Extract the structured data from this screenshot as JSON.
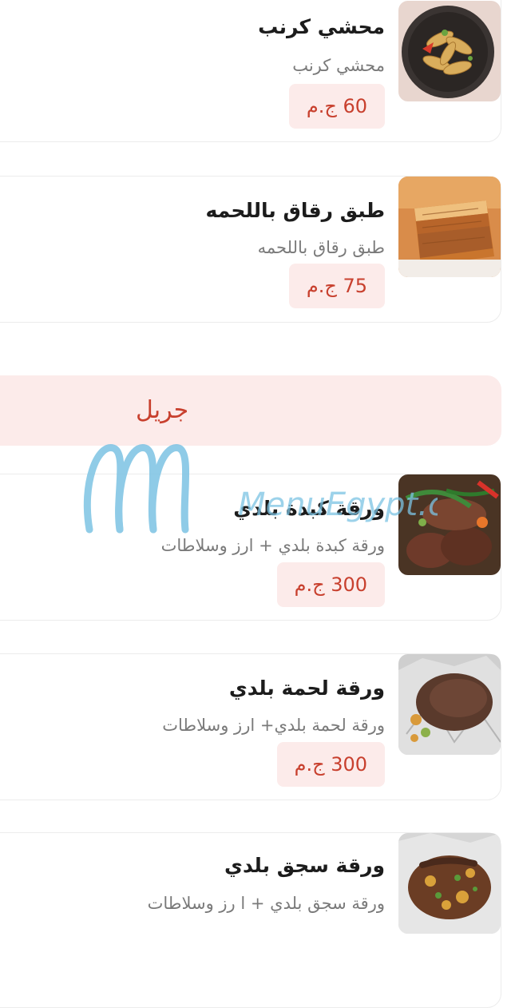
{
  "items_top": [
    {
      "title": "محشي كرنب",
      "description": "محشي كرنب",
      "price": "60 ج.م",
      "image": "stuffed-cabbage-photo"
    },
    {
      "title": "طبق رقاق باللحمه",
      "description": "طبق رقاق باللحمه",
      "price": "75 ج.م",
      "image": "roqaq-meat-photo"
    }
  ],
  "section": {
    "title": "جريل",
    "items": [
      {
        "title": "ورقة كبدة بلدي",
        "description": "ورقة كبدة بلدي + ارز وسلاطات",
        "price": "300 ج.م",
        "image": "liver-paper-photo"
      },
      {
        "title": "ورقة لحمة بلدي",
        "description": "ورقة لحمة بلدي+ ارز وسلاطات",
        "price": "300 ج.م",
        "image": "meat-paper-photo"
      },
      {
        "title": "ورقة سجق بلدي",
        "description": "ورقة سجق بلدي + ا رز وسلاطات",
        "image": "sausage-paper-photo"
      }
    ]
  },
  "watermark": {
    "text": "MenuEgypt.com"
  },
  "colors": {
    "accent": "#c8402e",
    "price_bg": "#fcebea",
    "section_bg": "#fcebea",
    "watermark": "#7cc3e3"
  }
}
